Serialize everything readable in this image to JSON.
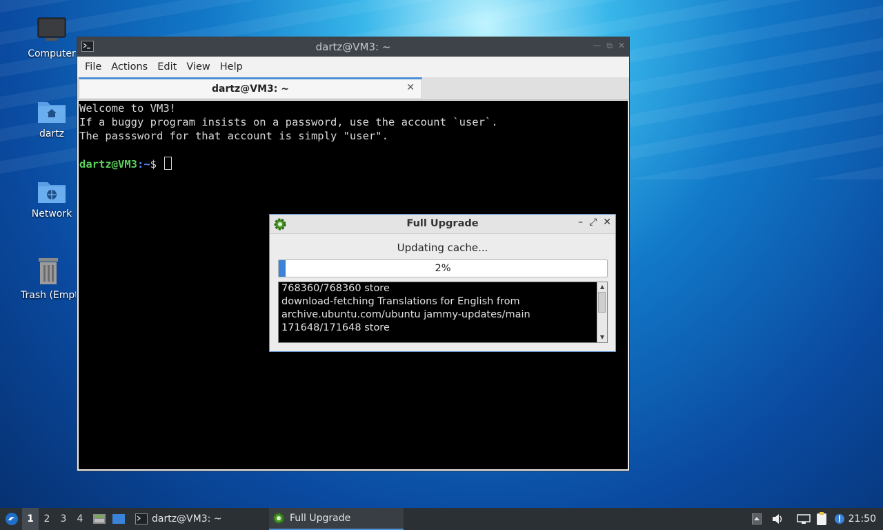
{
  "desktop": {
    "icons": [
      {
        "label": "Computer"
      },
      {
        "label": "dartz"
      },
      {
        "label": "Network"
      },
      {
        "label": "Trash (Empty)"
      }
    ]
  },
  "terminal": {
    "window_title": "dartz@VM3: ~",
    "menu": [
      "File",
      "Actions",
      "Edit",
      "View",
      "Help"
    ],
    "tab_label": "dartz@VM3: ~",
    "lines": [
      "Welcome to VM3!",
      "If a buggy program insists on a password, use the account `user`.",
      "The passsword for that account is simply \"user\"."
    ],
    "prompt_user": "dartz@VM3",
    "prompt_path": ":~",
    "prompt_symbol": "$"
  },
  "dialog": {
    "title": "Full Upgrade",
    "status": "Updating cache...",
    "progress_value": 2,
    "progress_text": "2%",
    "log": [
      "768360/768360 store",
      "download-fetching Translations for English from",
      "archive.ubuntu.com/ubuntu jammy-updates/main",
      "171648/171648 store"
    ]
  },
  "taskbar": {
    "workspaces": [
      "1",
      "2",
      "3",
      "4"
    ],
    "active_workspace": "1",
    "tasks": [
      {
        "label": "dartz@VM3: ~"
      },
      {
        "label": "Full Upgrade"
      }
    ],
    "clock": "21:50"
  },
  "colors": {
    "accent": "#4e8ed6",
    "prompt_user": "#5ad05a",
    "prompt_path": "#5a8cff",
    "progress_fill": "#3b83d9"
  }
}
